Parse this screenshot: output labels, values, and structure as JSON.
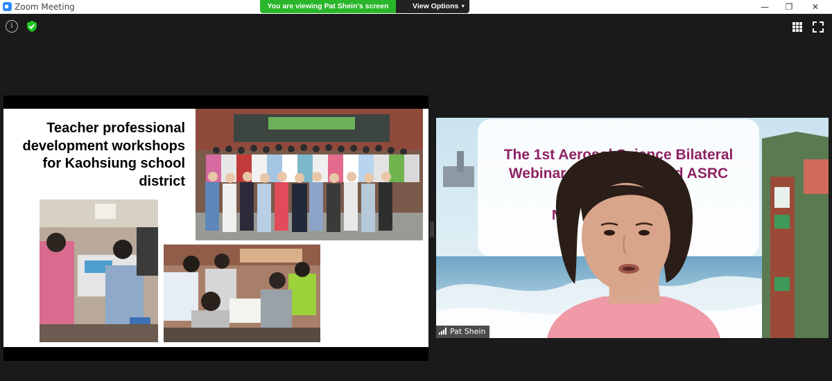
{
  "window": {
    "title": "Zoom Meeting",
    "controls": {
      "minimize": "—",
      "restore": "❐",
      "close": "✕"
    }
  },
  "share_banner": {
    "status": "You are viewing Pat Shein's screen",
    "options_label": "View Options"
  },
  "toolbar_icons": [
    "info-icon",
    "shield-icon",
    "gallery-view-icon",
    "fullscreen-icon"
  ],
  "slide": {
    "title_lines": [
      "Teacher professional",
      "development workshops",
      "for Kaohsiung school",
      "district"
    ]
  },
  "video": {
    "participant_name": "Pat Shein",
    "background_title_lines": [
      "The 1st Aerosol Science Bilateral",
      "Webinar of",
      "nd ASRC"
    ],
    "background_sub": "N                              0"
  },
  "colors": {
    "banner_green": "#2ab62a",
    "webinar_text": "#8e2363",
    "background": "#1a1a1a"
  }
}
